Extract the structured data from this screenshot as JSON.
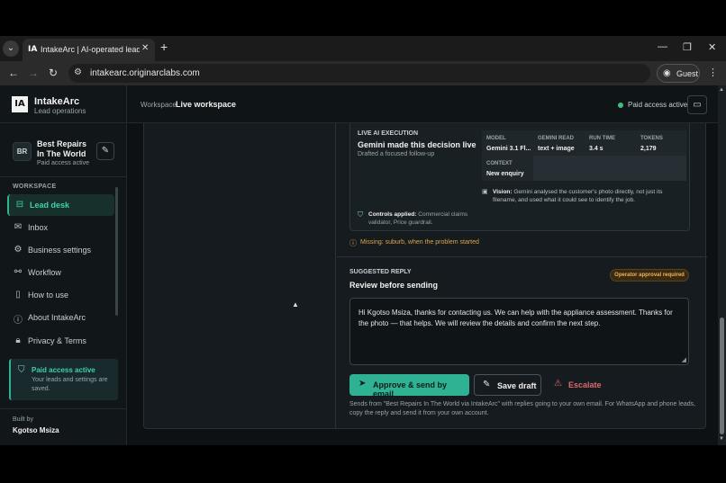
{
  "browser": {
    "tab_title": "IntakeArc | AI-operated lead desk",
    "url": "intakearc.originarclabs.com",
    "profile": "Guest"
  },
  "sidebar": {
    "brand": {
      "logo": "IA",
      "name": "IntakeArc",
      "tagline": "Lead operations"
    },
    "business": {
      "initials": "BR",
      "name": "Best Repairs In The World",
      "status": "Paid access active"
    },
    "section_label": "WORKSPACE",
    "items": [
      {
        "label": "Lead desk",
        "icon": "inbox-tray-icon",
        "active": true
      },
      {
        "label": "Inbox",
        "icon": "inbox-icon"
      },
      {
        "label": "Business settings",
        "icon": "gear-icon"
      },
      {
        "label": "Workflow",
        "icon": "workflow-icon"
      },
      {
        "label": "How to use",
        "icon": "book-icon"
      },
      {
        "label": "About IntakeArc",
        "icon": "info-icon"
      },
      {
        "label": "Privacy & Terms",
        "icon": "lock-icon"
      }
    ],
    "paid_card": {
      "title": "Paid access active",
      "text": "Your leads and settings are saved."
    },
    "built_by_label": "Built by",
    "built_by_name": "Kgotso Msiza"
  },
  "header": {
    "crumb_parent": "Workspace",
    "crumb_current": "Live workspace",
    "status": "Paid access active"
  },
  "ai": {
    "kicker": "LIVE AI EXECUTION",
    "title": "Gemini made this decision live",
    "subtitle": "Drafted a focused follow-up",
    "stats": [
      {
        "key": "MODEL",
        "value": "Gemini 3.1 Fl..."
      },
      {
        "key": "GEMINI READ",
        "value": "text + image"
      },
      {
        "key": "RUN TIME",
        "value": "3.4 s"
      },
      {
        "key": "TOKENS",
        "value": "2,179"
      },
      {
        "key": "CONTEXT",
        "value": "New enquiry"
      }
    ],
    "vision_label": "Vision:",
    "vision_text": "Gemini analysed the customer's photo directly, not just its filename, and used what it could see to identify the job.",
    "controls_label": "Controls applied:",
    "controls_text": "Commercial claims validator, Price guardrail."
  },
  "missing": "Missing: suburb, when the problem started",
  "reply": {
    "kicker": "SUGGESTED REPLY",
    "title": "Review before sending",
    "badge": "Operator approval required",
    "text": "Hi Kgotso Msiza, thanks for contacting us. We can help with the appliance assessment. Thanks for the photo — that helps. We will review the details and confirm the next step.",
    "approve_label": "Approve & send by email",
    "draft_label": "Save draft",
    "escalate_label": "Escalate",
    "footnote": "Sends from \"Best Repairs In The World via IntakeArc\" with replies going to your own email. For WhatsApp and phone leads, copy the reply and send it from your own account."
  },
  "colors": {
    "accent": "#2fb294",
    "warning": "#e0a44a",
    "danger": "#e06a6a",
    "background": "#0d1114"
  }
}
